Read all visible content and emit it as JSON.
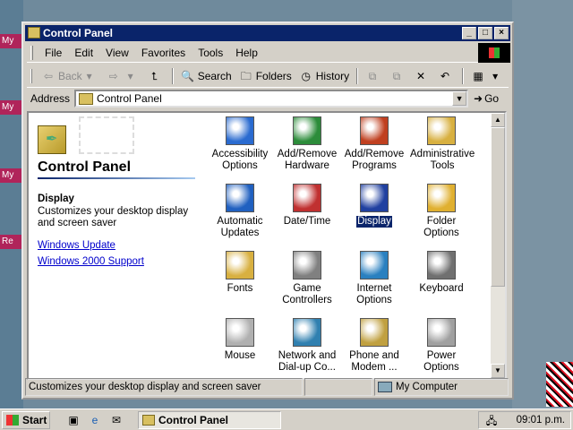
{
  "desktop": {
    "icons": [
      "My D",
      "My",
      "My",
      "Re"
    ]
  },
  "window": {
    "title": "Control Panel",
    "min_label": "_",
    "max_label": "□",
    "close_label": "×"
  },
  "menu": [
    "File",
    "Edit",
    "View",
    "Favorites",
    "Tools",
    "Help"
  ],
  "toolbar": {
    "back": "Back",
    "search": "Search",
    "folders": "Folders",
    "history": "History"
  },
  "address": {
    "label": "Address",
    "value": "Control Panel",
    "go": "Go"
  },
  "leftpane": {
    "title": "Control Panel",
    "selected_title": "Display",
    "selected_desc": "Customizes your desktop display and screen saver",
    "links": [
      "Windows Update",
      "Windows 2000 Support"
    ]
  },
  "items": [
    {
      "label": "Accessibility Options",
      "icon": "accessibility-icon",
      "color": "#2a6bd0"
    },
    {
      "label": "Add/Remove Hardware",
      "icon": "hardware-icon",
      "color": "#2c8c3a"
    },
    {
      "label": "Add/Remove Programs",
      "icon": "programs-icon",
      "color": "#c04020"
    },
    {
      "label": "Administrative Tools",
      "icon": "admin-tools-icon",
      "color": "#d8b040"
    },
    {
      "label": "Automatic Updates",
      "icon": "updates-icon",
      "color": "#2060c0"
    },
    {
      "label": "Date/Time",
      "icon": "clock-icon",
      "color": "#c03030"
    },
    {
      "label": "Display",
      "icon": "display-icon",
      "color": "#2040a0"
    },
    {
      "label": "Folder Options",
      "icon": "folder-options-icon",
      "color": "#e0b030"
    },
    {
      "label": "Fonts",
      "icon": "fonts-icon",
      "color": "#d8b040"
    },
    {
      "label": "Game Controllers",
      "icon": "joystick-icon",
      "color": "#808080"
    },
    {
      "label": "Internet Options",
      "icon": "globe-icon",
      "color": "#2a80c0"
    },
    {
      "label": "Keyboard",
      "icon": "keyboard-icon",
      "color": "#707070"
    },
    {
      "label": "Mouse",
      "icon": "mouse-icon",
      "color": "#b0b0b0"
    },
    {
      "label": "Network and Dial-up Co...",
      "icon": "network-icon",
      "color": "#3080b0"
    },
    {
      "label": "Phone and Modem ...",
      "icon": "phone-icon",
      "color": "#c0a040"
    },
    {
      "label": "Power Options",
      "icon": "power-icon",
      "color": "#a0a0a0"
    }
  ],
  "selected_index": 6,
  "status": {
    "text": "Customizes your desktop display and screen saver",
    "zone": "My Computer"
  },
  "taskbar": {
    "start": "Start",
    "task": "Control Panel",
    "clock": "09:01 p.m."
  }
}
